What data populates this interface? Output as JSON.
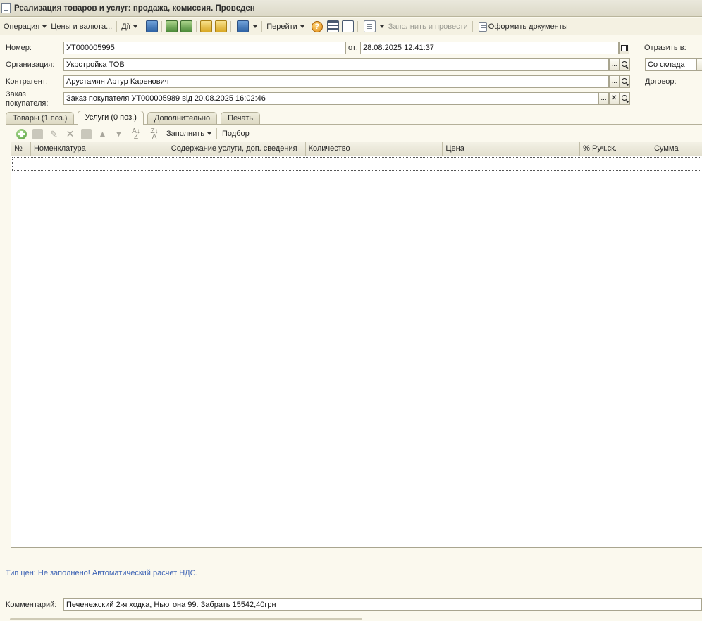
{
  "window": {
    "title": "Реализация товаров и услуг: продажа, комиссия. Проведен"
  },
  "toolbar": {
    "operation": "Операция",
    "prices": "Цены и валюта...",
    "actions": "Дії",
    "goto": "Перейти",
    "fill_and_post": "Заполнить и провести",
    "make_docs": "Оформить документы"
  },
  "form": {
    "number_label": "Номер:",
    "number_value": "УТ000005995",
    "date_label": "от:",
    "date_value": "28.08.2025 12:41:37",
    "reflect_label": "Отразить в:",
    "reflect_value": "Со склада",
    "org_label": "Организация:",
    "org_value": "Укрстройка ТОВ",
    "counterparty_label": "Контрагент:",
    "counterparty_value": "Арустамян Артур Каренович",
    "contract_label": "Договор:",
    "order_label_1": "Заказ",
    "order_label_2": "покупателя:",
    "order_value": "Заказ покупателя УТ000005989 від 20.08.2025 16:02:46"
  },
  "tabs": [
    {
      "label": "Товары (1 поз.)"
    },
    {
      "label": "Услуги (0 поз.)"
    },
    {
      "label": "Дополнительно"
    },
    {
      "label": "Печать"
    }
  ],
  "grid_toolbar": {
    "fill": "Заполнить",
    "pick": "Подбор"
  },
  "grid": {
    "columns": [
      "№",
      "Номенклатура",
      "Содержание услуги, доп. сведения",
      "Количество",
      "Цена",
      "% Руч.ск.",
      "Сумма"
    ]
  },
  "status_text": "Тип цен: Не заполнено! Автоматический расчет НДС.",
  "comment": {
    "label": "Комментарий:",
    "value": "Печенежский 2-я ходка, Ньютона 99. Забрать 15542,40грн"
  },
  "buttons": {
    "ellipsis": "...",
    "clear": "✕"
  }
}
